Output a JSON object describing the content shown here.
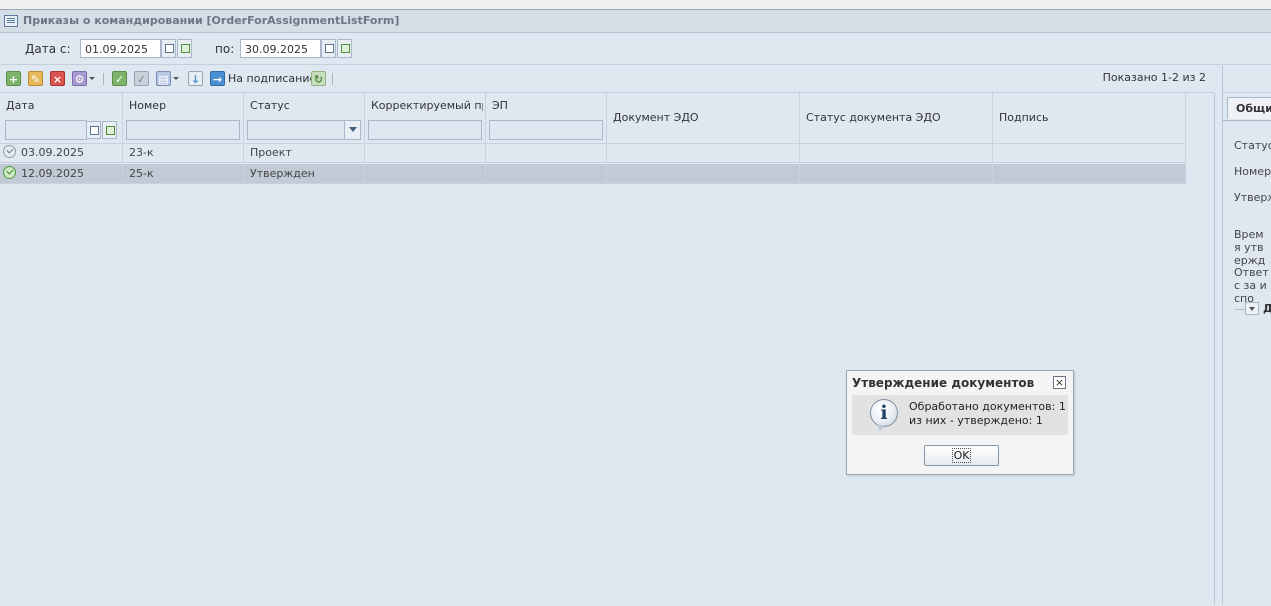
{
  "window": {
    "title": "Приказы о командировании [OrderForAssignmentListForm]"
  },
  "filters": {
    "date_from_label": "Дата с:",
    "date_from_value": "01.09.2025",
    "date_to_label": "по:",
    "date_to_value": "30.09.2025"
  },
  "toolbar": {
    "add_icon": "add-icon",
    "edit_icon": "edit-icon",
    "delete_icon": "delete-icon",
    "sign_label": "На подписание",
    "shown_text": "Показано 1-2 из 2"
  },
  "grid": {
    "columns": [
      "Дата",
      "Номер",
      "Статус",
      "Корректируемый пр...",
      "ЭП",
      "Документ ЭДО",
      "Статус документа ЭДО",
      "Подпись"
    ],
    "rows": [
      {
        "date": "03.09.2025",
        "number": "23-к",
        "status": "Проект",
        "selected": false
      },
      {
        "date": "12.09.2025",
        "number": "25-к",
        "status": "Утвержден",
        "selected": true
      }
    ]
  },
  "right_panel": {
    "tab_label": "Общие",
    "fields": [
      "Статус",
      "Номер",
      "Утвержд",
      "Время утвержд",
      "Ответс за испо"
    ],
    "section_label": "Д"
  },
  "dialog": {
    "title": "Утверждение документов",
    "line1": "Обработано документов: 1",
    "line2": "из них - утверждено: 1",
    "ok_label": "OK"
  }
}
